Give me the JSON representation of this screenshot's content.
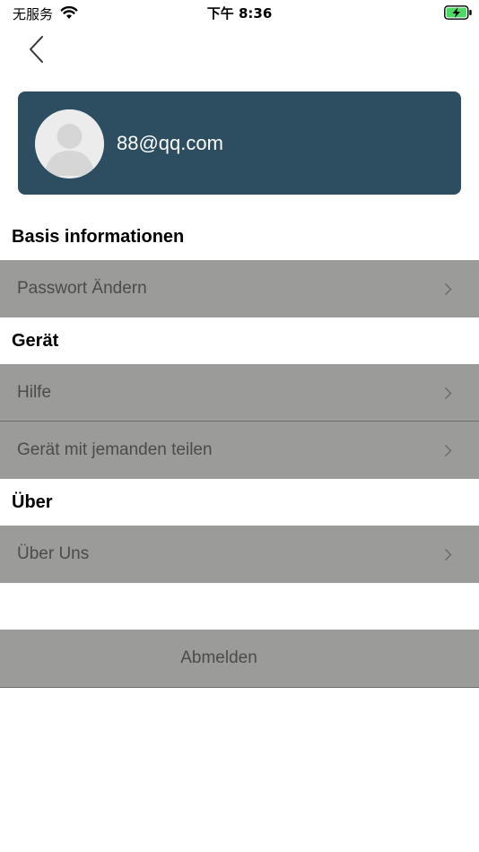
{
  "status_bar": {
    "carrier": "无服务",
    "time": "下午 8:36",
    "wifi_icon": "wifi-icon",
    "battery_icon": "battery-charging-icon"
  },
  "nav": {
    "back_icon": "chevron-left-icon"
  },
  "profile": {
    "email": "88@qq.com",
    "avatar_icon": "default-avatar-icon",
    "card_color": "#2d4d61"
  },
  "sections": {
    "basis": {
      "title": "Basis informationen",
      "items": [
        {
          "label": "Passwort Ändern"
        }
      ]
    },
    "device": {
      "title": "Gerät",
      "items": [
        {
          "label": "Hilfe"
        },
        {
          "label": "Gerät mit jemanden teilen"
        }
      ]
    },
    "about": {
      "title": "Über",
      "items": [
        {
          "label": "Über Uns"
        }
      ]
    }
  },
  "logout": {
    "label": "Abmelden"
  },
  "colors": {
    "row_background": "#9b9b9a",
    "row_text": "#4b4b4b",
    "battery_fill": "#4cd964"
  }
}
